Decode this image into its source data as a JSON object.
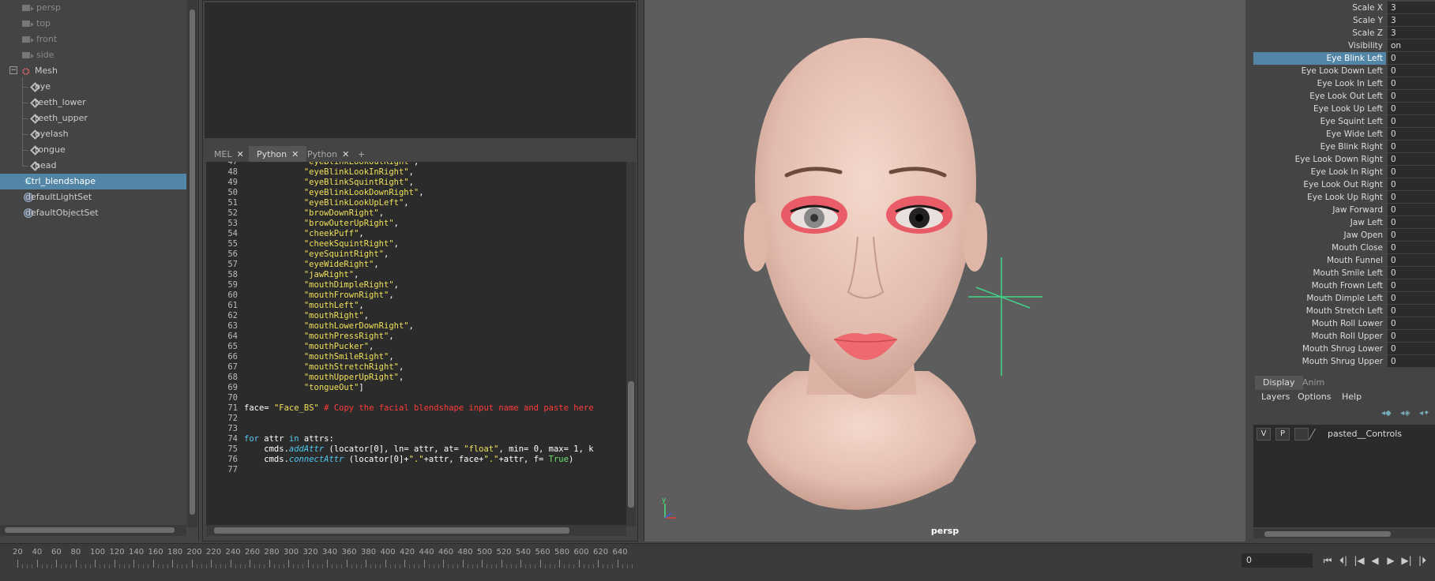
{
  "outliner": {
    "items": [
      {
        "label": "persp"
      },
      {
        "label": "top"
      },
      {
        "label": "front"
      },
      {
        "label": "side"
      },
      {
        "label": "Mesh"
      },
      {
        "label": "eye"
      },
      {
        "label": "teeth_lower"
      },
      {
        "label": "teeth_upper"
      },
      {
        "label": "eyelash"
      },
      {
        "label": "tongue"
      },
      {
        "label": "head"
      },
      {
        "label": "Ctrl_blendshape"
      },
      {
        "label": "defaultLightSet"
      },
      {
        "label": "defaultObjectSet"
      }
    ]
  },
  "script_editor": {
    "tabs": [
      {
        "label": "MEL"
      },
      {
        "label": "Python"
      },
      {
        "label": "Python"
      },
      {
        "label": "+"
      }
    ],
    "close_glyph": "✕",
    "lines": [
      {
        "n": "47",
        "text": "            \"eyeBlinkLookOutRight\","
      },
      {
        "n": "48",
        "text": "            \"eyeBlinkLookInRight\","
      },
      {
        "n": "49",
        "text": "            \"eyeBlinkSquintRight\","
      },
      {
        "n": "50",
        "text": "            \"eyeBlinkLookDownRight\","
      },
      {
        "n": "51",
        "text": "            \"eyeBlinkLookUpLeft\","
      },
      {
        "n": "52",
        "text": "            \"browDownRight\","
      },
      {
        "n": "53",
        "text": "            \"browOuterUpRight\","
      },
      {
        "n": "54",
        "text": "            \"cheekPuff\","
      },
      {
        "n": "55",
        "text": "            \"cheekSquintRight\","
      },
      {
        "n": "56",
        "text": "            \"eyeSquintRight\","
      },
      {
        "n": "57",
        "text": "            \"eyeWideRight\","
      },
      {
        "n": "58",
        "text": "            \"jawRight\","
      },
      {
        "n": "59",
        "text": "            \"mouthDimpleRight\","
      },
      {
        "n": "60",
        "text": "            \"mouthFrownRight\","
      },
      {
        "n": "61",
        "text": "            \"mouthLeft\","
      },
      {
        "n": "62",
        "text": "            \"mouthRight\","
      },
      {
        "n": "63",
        "text": "            \"mouthLowerDownRight\","
      },
      {
        "n": "64",
        "text": "            \"mouthPressRight\","
      },
      {
        "n": "65",
        "text": "            \"mouthPucker\","
      },
      {
        "n": "66",
        "text": "            \"mouthSmileRight\","
      },
      {
        "n": "67",
        "text": "            \"mouthStretchRight\","
      },
      {
        "n": "68",
        "text": "            \"mouthUpperUpRight\","
      },
      {
        "n": "69",
        "text": "            \"tongueOut\"]"
      },
      {
        "n": "70",
        "text": ""
      },
      {
        "n": "71",
        "text": "face= \"Face_BS\" # Copy the facial blendshape input name and paste here"
      },
      {
        "n": "72",
        "text": ""
      },
      {
        "n": "73",
        "text": ""
      },
      {
        "n": "74",
        "text": "for attr in attrs:"
      },
      {
        "n": "75",
        "text": "    cmds.addAttr (locator[0], ln= attr, at= \"float\", min= 0, max= 1, k"
      },
      {
        "n": "76",
        "text": "    cmds.connectAttr (locator[0]+\".\"+attr, face+\".\"+attr, f= True)"
      },
      {
        "n": "77",
        "text": ""
      }
    ]
  },
  "viewport": {
    "camera_label": "persp",
    "axis_y": "y",
    "skin_color": "#e9c6b8",
    "eyeshadow_color": "#e8505e",
    "lip_color": "#ef6a70",
    "locator_color": "#3fd68a"
  },
  "channel_box": {
    "attributes": [
      {
        "name": "Scale X",
        "value": "3"
      },
      {
        "name": "Scale Y",
        "value": "3"
      },
      {
        "name": "Scale Z",
        "value": "3"
      },
      {
        "name": "Visibility",
        "value": "on"
      },
      {
        "name": "Eye Blink Left",
        "value": "0"
      },
      {
        "name": "Eye Look Down Left",
        "value": "0"
      },
      {
        "name": "Eye Look In Left",
        "value": "0"
      },
      {
        "name": "Eye Look Out Left",
        "value": "0"
      },
      {
        "name": "Eye Look Up Left",
        "value": "0"
      },
      {
        "name": "Eye Squint Left",
        "value": "0"
      },
      {
        "name": "Eye Wide Left",
        "value": "0"
      },
      {
        "name": "Eye Blink Right",
        "value": "0"
      },
      {
        "name": "Eye Look Down Right",
        "value": "0"
      },
      {
        "name": "Eye Look In Right",
        "value": "0"
      },
      {
        "name": "Eye Look Out Right",
        "value": "0"
      },
      {
        "name": "Eye Look Up Right",
        "value": "0"
      },
      {
        "name": "Jaw Forward",
        "value": "0"
      },
      {
        "name": "Jaw Left",
        "value": "0"
      },
      {
        "name": "Jaw Open",
        "value": "0"
      },
      {
        "name": "Mouth Close",
        "value": "0"
      },
      {
        "name": "Mouth Funnel",
        "value": "0"
      },
      {
        "name": "Mouth Smile Left",
        "value": "0"
      },
      {
        "name": "Mouth Frown Left",
        "value": "0"
      },
      {
        "name": "Mouth Dimple Left",
        "value": "0"
      },
      {
        "name": "Mouth Stretch Left",
        "value": "0"
      },
      {
        "name": "Mouth Roll Lower",
        "value": "0"
      },
      {
        "name": "Mouth Roll Upper",
        "value": "0"
      },
      {
        "name": "Mouth Shrug Lower",
        "value": "0"
      },
      {
        "name": "Mouth Shrug Upper",
        "value": "0"
      }
    ],
    "selected_index": 4
  },
  "layers": {
    "tabs": [
      {
        "label": "Display"
      },
      {
        "label": "Anim"
      }
    ],
    "menu": [
      {
        "label": "Layers"
      },
      {
        "label": "Options"
      },
      {
        "label": "Help"
      }
    ],
    "row": {
      "v": "V",
      "p": "P",
      "name": "pasted__Controls"
    }
  },
  "timeline": {
    "ticks": [
      "20",
      "40",
      "60",
      "80",
      "100",
      "120",
      "140",
      "160",
      "180",
      "200",
      "220",
      "240",
      "260",
      "280",
      "300",
      "320",
      "340",
      "360",
      "380",
      "400",
      "420",
      "440",
      "460",
      "480",
      "500",
      "520",
      "540",
      "560",
      "580",
      "600",
      "620",
      "640"
    ],
    "current_frame": "0",
    "controls": [
      "⏮",
      "⏴|",
      "|◀",
      "◀",
      "▶",
      "▶|",
      "|⏵"
    ]
  }
}
